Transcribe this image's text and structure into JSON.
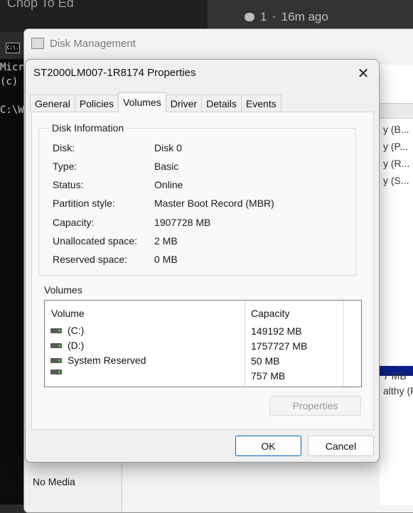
{
  "chat": {
    "left_text": "Chop To Ed",
    "reply_count": "1",
    "time_ago": "16m ago"
  },
  "console": {
    "icon_label": "C:\\.",
    "line1": "Micr",
    "line2": "(c)",
    "line3": "C:\\W"
  },
  "disk_management": {
    "title": "Disk Management",
    "right_rows": [
      "y (B...",
      "y (P...",
      "y (R...",
      "y (S..."
    ],
    "right_lower1": "7 MB",
    "right_lower2": "althy (R",
    "no_media": "No Media"
  },
  "dialog": {
    "title": "ST2000LM007-1R8174 Properties",
    "tabs": [
      "General",
      "Policies",
      "Volumes",
      "Driver",
      "Details",
      "Events"
    ],
    "active_tab": "Volumes",
    "disk_info_legend": "Disk Information",
    "info": [
      {
        "label": "Disk:",
        "value": "Disk 0"
      },
      {
        "label": "Type:",
        "value": "Basic"
      },
      {
        "label": "Status:",
        "value": "Online"
      },
      {
        "label": "Partition style:",
        "value": "Master Boot Record (MBR)"
      },
      {
        "label": "Capacity:",
        "value": "1907728 MB"
      },
      {
        "label": "Unallocated space:",
        "value": "2 MB"
      },
      {
        "label": "Reserved space:",
        "value": "0 MB"
      }
    ],
    "volumes_label": "Volumes",
    "volume_columns": [
      "Volume",
      "Capacity"
    ],
    "volumes": [
      {
        "name": "(C:)",
        "capacity": "149192 MB"
      },
      {
        "name": "(D:)",
        "capacity": "1757727 MB"
      },
      {
        "name": "System Reserved",
        "capacity": "50 MB"
      },
      {
        "name": "",
        "capacity": "757 MB"
      }
    ],
    "properties_button": "Properties",
    "ok_button": "OK",
    "cancel_button": "Cancel"
  },
  "colors": {
    "accent": "#0067c0",
    "drive_light": "#3ad13a"
  }
}
